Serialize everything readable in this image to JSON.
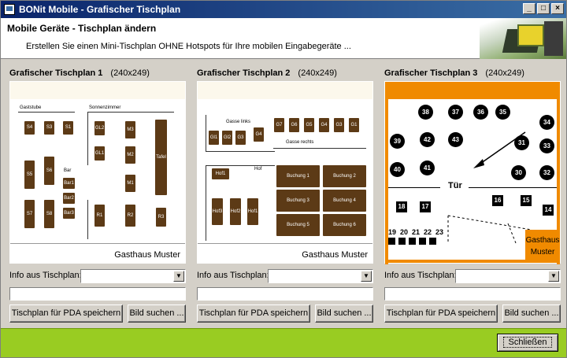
{
  "window": {
    "title": "BONit Mobile - Grafischer Tischplan"
  },
  "header": {
    "title": "Mobile Geräte - Tischplan ändern",
    "subtitle": "Erstellen Sie einen Mini-Tischplan OHNE Hotspots für Ihre mobilen Eingabegeräte ..."
  },
  "panels": [
    {
      "title": "Grafischer Tischplan 1",
      "size": "(240x249)",
      "plan_rooms": [
        "Gaststube",
        "Sonnenzimmer"
      ],
      "tables_left": [
        "S4",
        "S3",
        "S1",
        "S5",
        "S6",
        "S7",
        "S8"
      ],
      "tables_mid": [
        "Bar1",
        "Bar2",
        "Bar3"
      ],
      "tables_right": [
        "GL2",
        "GL1",
        "M3",
        "M2",
        "M1",
        "R1",
        "R2",
        "R3"
      ],
      "bar_label": "Bar",
      "big_table": "Tafel",
      "footer_name": "Gasthaus Muster"
    },
    {
      "title": "Grafischer Tischplan 2",
      "size": "(240x249)",
      "room_top_left": "Gasse links",
      "room_top_right": "Gasse rechts",
      "room_mid": "Hof",
      "tables_gl": [
        "Gl1",
        "Gl2",
        "G3",
        "G4"
      ],
      "tables_gr": [
        "G7",
        "G6",
        "G5",
        "G4",
        "G3",
        "G1"
      ],
      "tables_hof": [
        "Hof1",
        "Hof3",
        "Hof2",
        "Hof1"
      ],
      "bookings": [
        "Buchung 1",
        "Buchung 2",
        "Buchung 3",
        "Buchung 4",
        "Buchung 5",
        "Buchung 6"
      ],
      "footer_name": "Gasthaus Muster"
    },
    {
      "title": "Grafischer Tischplan 3",
      "size": "(240x249)",
      "circles": [
        "38",
        "37",
        "36",
        "35",
        "34",
        "39",
        "42",
        "43",
        "31",
        "33",
        "40",
        "41",
        "30",
        "32"
      ],
      "door": "Tür",
      "squares": [
        "18",
        "17",
        "16",
        "15",
        "14"
      ],
      "row_nums": [
        "19",
        "20",
        "21",
        "22",
        "23"
      ],
      "footer_name_1": "Gasthaus",
      "footer_name_2": "Muster"
    }
  ],
  "controls": {
    "info_label": "Info aus Tischplan:",
    "save_label": "Tischplan für PDA speichern",
    "search_label": "Bild suchen ..."
  },
  "footer": {
    "close_label": "Schließen"
  }
}
